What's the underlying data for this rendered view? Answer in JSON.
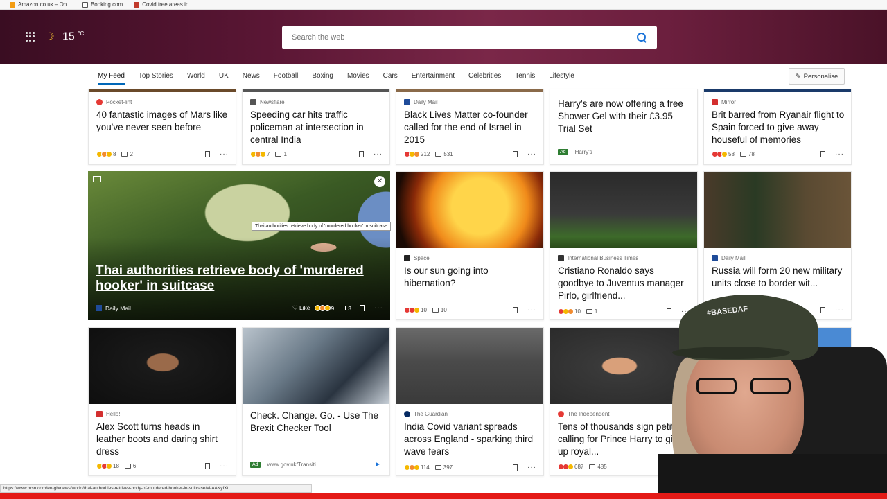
{
  "bookmarks": [
    {
      "label": "Amazon.co.uk – On...",
      "color": "#f39c12"
    },
    {
      "label": "Booking.com",
      "color": "#555555"
    },
    {
      "label": "Covid free areas in...",
      "color": "#c0392b"
    }
  ],
  "weather": {
    "temp": "15",
    "unit": "°C"
  },
  "search": {
    "placeholder": "Search the web"
  },
  "nav": {
    "tabs": [
      "My Feed",
      "Top Stories",
      "World",
      "UK",
      "News",
      "Football",
      "Boxing",
      "Movies",
      "Cars",
      "Entertainment",
      "Celebrities",
      "Tennis",
      "Lifestyle"
    ],
    "personalise": "Personalise"
  },
  "row1": [
    {
      "source": "Pocket-lint",
      "logo_color": "#e53935",
      "title": "40 fantastic images of Mars like you've never seen before",
      "reactions": "8",
      "comments": "2"
    },
    {
      "source": "Newsflare",
      "logo_color": "#555555",
      "title": "Speeding car hits traffic policeman at intersection in central India",
      "reactions": "7",
      "comments": "1"
    },
    {
      "source": "Daily Mail",
      "logo_color": "#1f4b99",
      "title": "Black Lives Matter co-founder called for the end of Israel in 2015",
      "reactions": "212",
      "comments": "531"
    },
    {
      "source": "Harry's",
      "ad_label": "Ad",
      "title": "Harry's are now offering a free Shower Gel with their £3.95 Trial Set"
    },
    {
      "source": "Mirror",
      "logo_color": "#d32f2f",
      "title": "Brit barred from Ryanair flight to Spain forced to give away houseful of memories",
      "reactions": "58",
      "comments": "78"
    }
  ],
  "featured": {
    "title": "Thai authorities retrieve body of 'murdered hooker' in suitcase",
    "source": "Daily Mail",
    "like_label": "Like",
    "reactions": "9",
    "comments": "3",
    "tooltip": "Thai authorities retrieve body of 'murdered hooker' in suitcase"
  },
  "row2": [
    {
      "source": "Space",
      "logo_color": "#222222",
      "title": "Is our sun going into hibernation?",
      "reactions": "10",
      "comments": "10"
    },
    {
      "source": "International Business Times",
      "logo_color": "#333333",
      "title": "Cristiano Ronaldo says goodbye to Juventus manager Pirlo, girlfriend...",
      "reactions": "10",
      "comments": "1"
    },
    {
      "source": "Daily Mail",
      "logo_color": "#1f4b99",
      "title": "Russia will form 20 new military units close to border wit..."
    }
  ],
  "row3": [
    {
      "source": "Hello!",
      "logo_color": "#d32f2f",
      "title": "Alex Scott turns heads in leather boots and daring shirt dress",
      "reactions": "18",
      "comments": "6"
    },
    {
      "ad_label": "Ad",
      "source": "www.gov.uk/Transiti...",
      "title": "Check. Change. Go. - Use The Brexit Checker Tool"
    },
    {
      "source": "The Guardian",
      "logo_color": "#052962",
      "title": "India Covid variant spreads across England - sparking third wave fears",
      "reactions": "114",
      "comments": "397"
    },
    {
      "source": "The Independent",
      "logo_color": "#e53935",
      "title": "Tens of thousands sign petition calling for Prince Harry to give up royal...",
      "reactions": "687",
      "comments": "485"
    }
  ],
  "status_url": "https://www.msn.com/en-gb/news/world/thai-authorities-retrieve-body-of-murdered-hooker-in-suitcase/vi-AAKyIXt",
  "webcam": {
    "cap_text": "#BASEDAF"
  },
  "colors": {
    "accent": "#0067b8",
    "hero": "#6c1f3e",
    "status_bar": "#e41b17"
  }
}
